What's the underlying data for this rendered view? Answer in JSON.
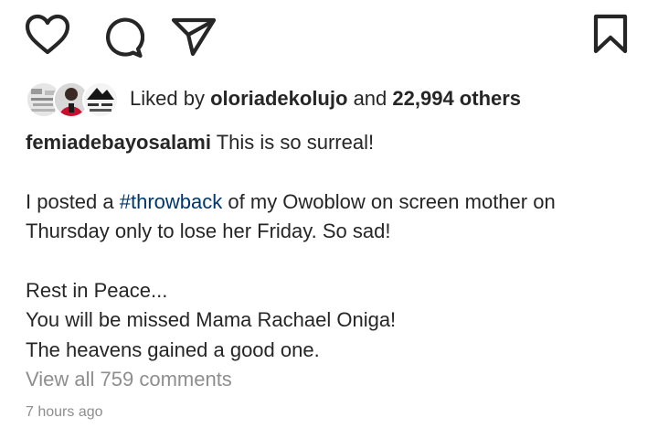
{
  "actions": {
    "like_icon": "heart-outline",
    "comment_icon": "speech-bubble",
    "share_icon": "paper-plane",
    "save_icon": "bookmark-outline"
  },
  "likes": {
    "prefix": "Liked by",
    "user": "oloriadekolujo",
    "joiner": "and",
    "others": "22,994 others"
  },
  "caption": {
    "username": "femiadebayosalami",
    "line1": "This is so surreal!",
    "p2_before": "I posted a",
    "hashtag": "#throwback",
    "p2_line1_after": "of my Owoblow on screen mother on",
    "p2_line2": "Thursday only to lose her Friday. So sad!",
    "p3_line1": "Rest in Peace...",
    "p3_line2": "You will be missed Mama Rachael Oniga!",
    "p3_line3": "The heavens gained a good one."
  },
  "comments": {
    "view_all": "View all 759 comments"
  },
  "timestamp": "7 hours ago"
}
